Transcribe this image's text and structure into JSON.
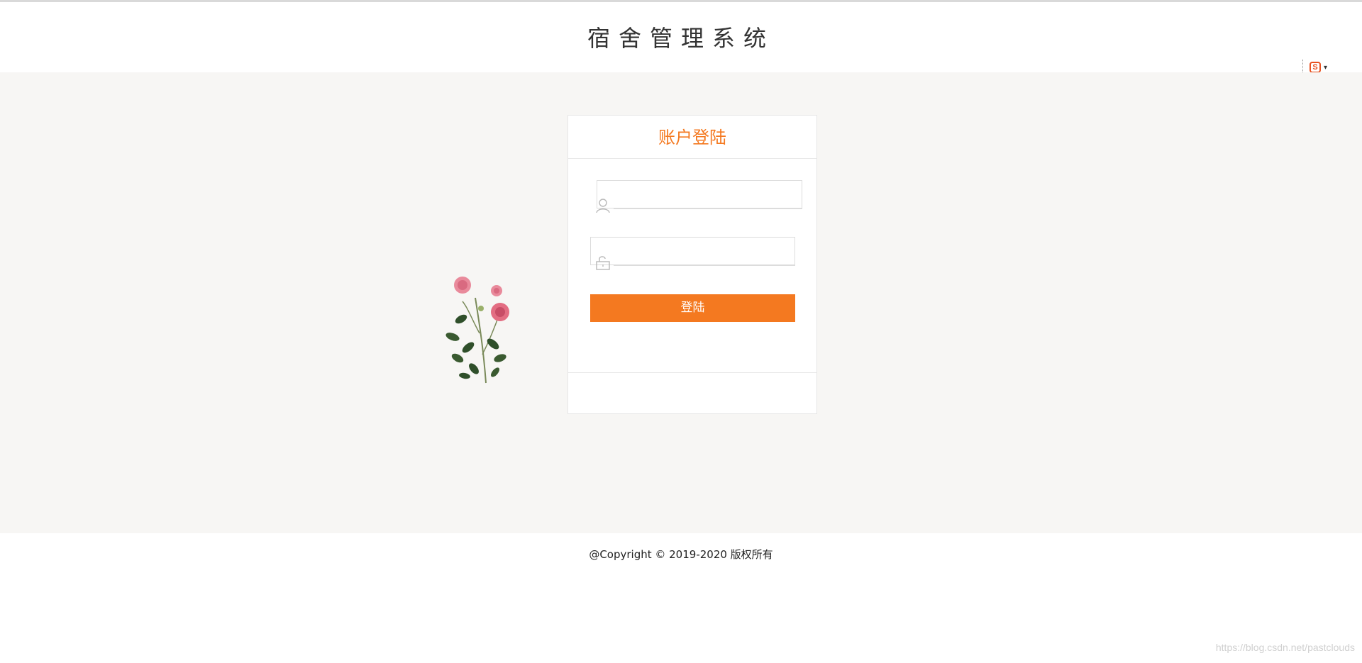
{
  "header": {
    "title": "宿舍管理系统"
  },
  "login": {
    "title": "账户登陆",
    "username_value": "",
    "password_value": "",
    "button_label": "登陆"
  },
  "footer": {
    "copyright": "@Copyright © 2019-2020 版权所有"
  },
  "watermark": "https://blog.csdn.net/pastclouds",
  "icons": {
    "user": "user-icon",
    "lock": "lock-icon",
    "ime": "sogou-ime-icon"
  },
  "colors": {
    "accent": "#f47920",
    "band_background": "#f7f6f4",
    "title_text": "#333333"
  }
}
